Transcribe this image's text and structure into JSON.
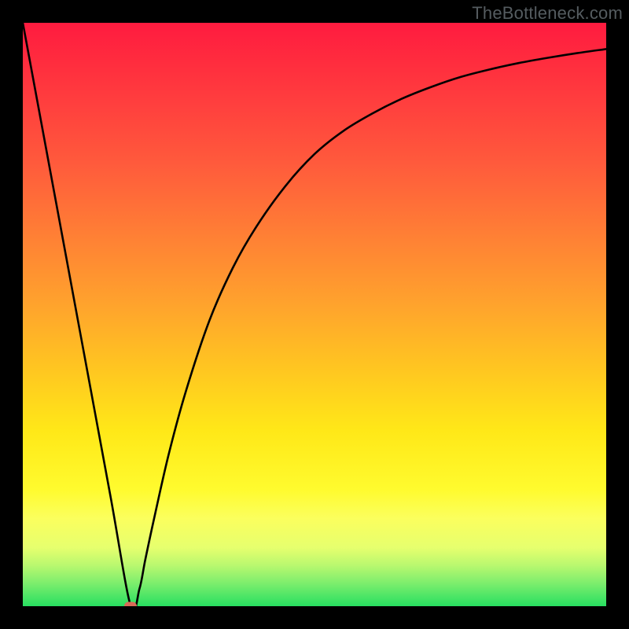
{
  "watermark": "TheBottleneck.com",
  "chart_data": {
    "type": "line",
    "title": "",
    "xlabel": "",
    "ylabel": "",
    "xlim": [
      0,
      100
    ],
    "ylim": [
      0,
      100
    ],
    "grid": false,
    "series": [
      {
        "name": "bottleneck-curve",
        "x": [
          0,
          5,
          10,
          15,
          18.5,
          20,
          21,
          22.5,
          25,
          28,
          32,
          36,
          40,
          45,
          50,
          55,
          60,
          65,
          70,
          75,
          80,
          85,
          90,
          95,
          100
        ],
        "y": [
          100,
          73,
          46,
          19,
          0,
          3,
          8,
          15,
          26,
          37,
          49,
          58,
          65,
          72,
          77.5,
          81.5,
          84.5,
          87,
          89,
          90.7,
          92,
          93.1,
          94,
          94.8,
          95.5
        ]
      }
    ],
    "marker": {
      "x": 18.5,
      "y": 0,
      "color": "#d96a58"
    },
    "background": {
      "type": "vertical-gradient",
      "stops": [
        {
          "pos": 0.0,
          "color": "#ff1b3f"
        },
        {
          "pos": 0.5,
          "color": "#ffc820"
        },
        {
          "pos": 0.82,
          "color": "#fffb2e"
        },
        {
          "pos": 1.0,
          "color": "#28df61"
        }
      ]
    }
  }
}
